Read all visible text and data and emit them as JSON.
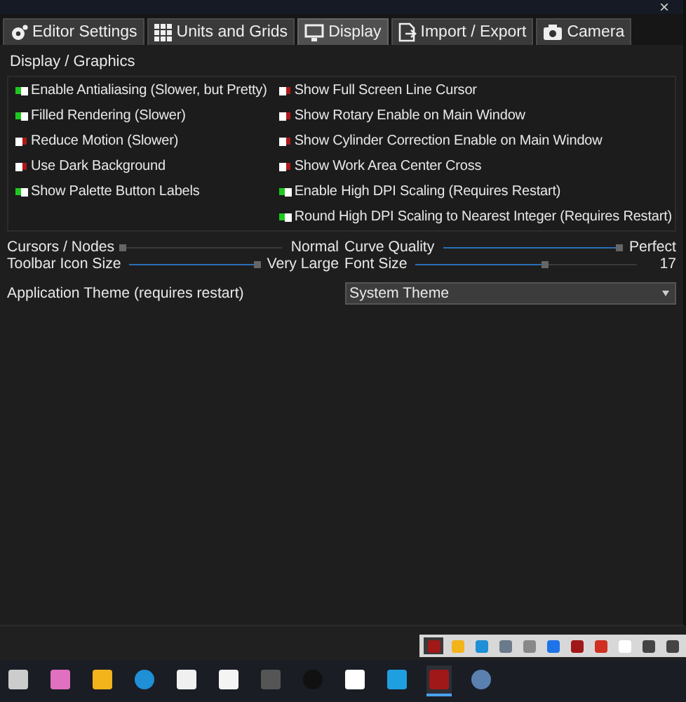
{
  "window": {
    "close": "×"
  },
  "tabs": [
    {
      "label": "Editor Settings",
      "selected": false
    },
    {
      "label": "Units and Grids",
      "selected": false
    },
    {
      "label": "Display",
      "selected": true
    },
    {
      "label": "Import / Export",
      "selected": false
    },
    {
      "label": "Camera",
      "selected": false
    }
  ],
  "group": {
    "title": "Display / Graphics",
    "left": [
      {
        "label": "Enable Antialiasing (Slower, but Pretty)",
        "checked": true
      },
      {
        "label": "Filled Rendering (Slower)",
        "checked": true
      },
      {
        "label": "Reduce Motion (Slower)",
        "checked": false
      },
      {
        "label": "Use Dark Background",
        "checked": false
      },
      {
        "label": "Show Palette Button Labels",
        "checked": true
      }
    ],
    "right": [
      {
        "label": "Show Full Screen Line Cursor",
        "checked": false
      },
      {
        "label": "Show Rotary Enable on Main Window",
        "checked": false
      },
      {
        "label": "Show Cylinder Correction Enable on Main Window",
        "checked": false
      },
      {
        "label": "Show Work Area Center Cross",
        "checked": false
      },
      {
        "label": "Enable High DPI Scaling (Requires Restart)",
        "checked": true
      },
      {
        "label": "Round High DPI Scaling to Nearest Integer (Requires Restart)",
        "checked": true
      }
    ]
  },
  "sliders": [
    {
      "label": "Cursors / Nodes",
      "level": 0.0,
      "reading": "Normal"
    },
    {
      "label": "Curve Quality",
      "level": 1.0,
      "reading": "Perfect"
    },
    {
      "label": "Toolbar Icon Size",
      "level": 1.0,
      "reading": "Very Large"
    },
    {
      "label": "Font Size",
      "level": 0.59,
      "reading": "17"
    }
  ],
  "theme": {
    "label": "Application Theme (requires restart)",
    "value": "System Theme"
  },
  "tray_toolbar": [
    {
      "selected": true
    },
    {
      "selected": false
    },
    {
      "selected": false
    },
    {
      "selected": false
    },
    {
      "selected": false
    },
    {
      "selected": false
    },
    {
      "selected": false
    },
    {
      "selected": false
    },
    {
      "selected": false
    },
    {
      "selected": false
    },
    {
      "selected": false
    }
  ],
  "taskbar": [
    {
      "selected": false
    },
    {
      "selected": false
    },
    {
      "selected": false
    },
    {
      "selected": false
    },
    {
      "selected": false
    },
    {
      "selected": false
    },
    {
      "selected": false
    },
    {
      "selected": false
    },
    {
      "selected": false
    },
    {
      "selected": false
    },
    {
      "selected": true
    },
    {
      "selected": false
    }
  ]
}
